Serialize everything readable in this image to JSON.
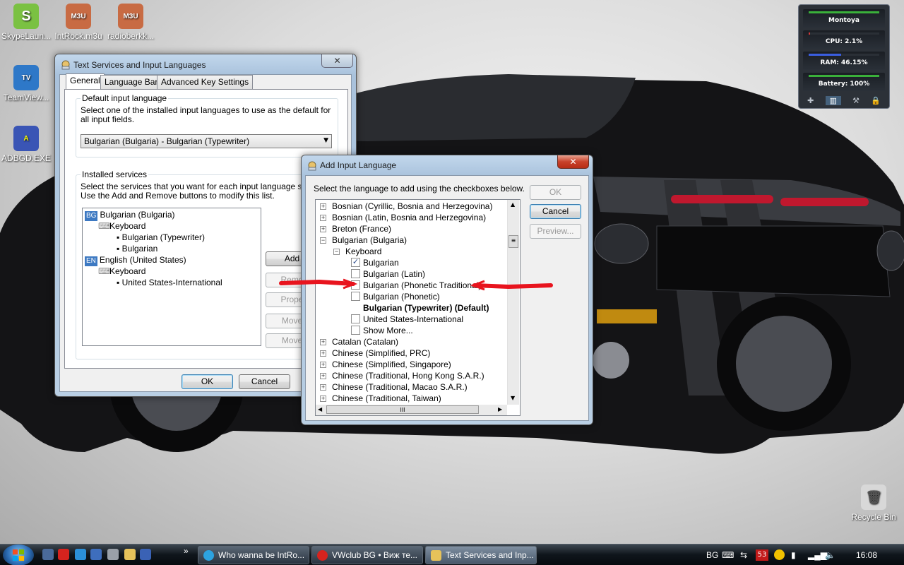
{
  "desktop_icons": [
    {
      "label": "SkypeLaun...",
      "color": "#7ac142",
      "glyph": "S"
    },
    {
      "label": "IntRock.m3u",
      "color": "#c86b43",
      "glyph": "M3U"
    },
    {
      "label": "radioberkk...",
      "color": "#c86b43",
      "glyph": "M3U"
    },
    {
      "label": "TeamView...",
      "color": "#2e78c8",
      "glyph": "TV"
    },
    {
      "label": "ADBGD.EXE",
      "color": "#3a55b5",
      "glyph": "A"
    },
    {
      "label": "Recycle Bin",
      "color": "#d8d8d8",
      "glyph": "🗑"
    }
  ],
  "gadget": {
    "name": "Montoya",
    "cpu": "CPU: 2.1%",
    "ram": "RAM: 46.15%",
    "battery": "Battery: 100%",
    "cpu_level": 0.021,
    "ram_level": 0.4615,
    "battery_level": 1.0,
    "tools": [
      "✚",
      "▥",
      "⚒",
      "🔒"
    ]
  },
  "text_services": {
    "title": "Text Services and Input Languages",
    "close": "✕",
    "tabs": [
      "General",
      "Language Bar",
      "Advanced Key Settings"
    ],
    "default_lang": {
      "legend": "Default input language",
      "description": "Select one of the installed input languages to use as the default for all input fields.",
      "selected": "Bulgarian (Bulgaria) - Bulgarian (Typewriter)"
    },
    "installed": {
      "legend": "Installed services",
      "description": "Select the services that you want for each input language shown i",
      "description2": "Use the Add and Remove buttons to modify this list.",
      "tree": [
        {
          "tag": "BG",
          "label": "Bulgarian (Bulgaria)"
        },
        {
          "label": "Keyboard"
        },
        {
          "label": "Bulgarian (Typewriter)"
        },
        {
          "label": "Bulgarian"
        },
        {
          "tag": "EN",
          "label": "English (United States)"
        },
        {
          "label": "Keyboard"
        },
        {
          "label": "United States-International"
        }
      ],
      "buttons": [
        "Add",
        "Remo",
        "Prope",
        "Move",
        "Move"
      ]
    },
    "ok": "OK",
    "cancel": "Cancel"
  },
  "add_input": {
    "title": "Add Input Language",
    "close": "✕",
    "instruction": "Select the language to add using the checkboxes below.",
    "ok": "OK",
    "cancel": "Cancel",
    "preview": "Preview...",
    "items": [
      {
        "label": "Bosnian (Cyrillic, Bosnia and Herzegovina)",
        "expander": "+"
      },
      {
        "label": "Bosnian (Latin, Bosnia and Herzegovina)",
        "expander": "+"
      },
      {
        "label": "Breton (France)",
        "expander": "+"
      },
      {
        "label": "Bulgarian (Bulgaria)",
        "expander": "−"
      },
      {
        "label": "Keyboard",
        "expander": "−"
      },
      {
        "label": "Bulgarian",
        "checked": true
      },
      {
        "label": "Bulgarian (Latin)",
        "checked": false
      },
      {
        "label": "Bulgarian (Phonetic Traditional)",
        "checked": false
      },
      {
        "label": "Bulgarian (Phonetic)",
        "checked": false
      },
      {
        "label": "Bulgarian (Typewriter) (Default)"
      },
      {
        "label": "United States-International",
        "checked": false
      },
      {
        "label": "Show More...",
        "checked": false
      },
      {
        "label": "Catalan (Catalan)",
        "expander": "+"
      },
      {
        "label": "Chinese (Simplified, PRC)",
        "expander": "+"
      },
      {
        "label": "Chinese (Simplified, Singapore)",
        "expander": "+"
      },
      {
        "label": "Chinese (Traditional, Hong Kong S.A.R.)",
        "expander": "+"
      },
      {
        "label": "Chinese (Traditional, Macao S.A.R.)",
        "expander": "+"
      },
      {
        "label": "Chinese (Traditional, Taiwan)",
        "expander": "+"
      }
    ],
    "hscroll_grip": "III",
    "annotation_color": "#e8141e"
  },
  "taskbar": {
    "quick_launch": [
      "show-desktop",
      "opera",
      "ie",
      "wordpad",
      "tools",
      "folder",
      "app"
    ],
    "quick_colors": [
      "#4a6a9a",
      "#d6231e",
      "#2b8fd8",
      "#3e6ebd",
      "#9aa0a8",
      "#e6c25a",
      "#3a62b5"
    ],
    "overflow": "»",
    "tasks": [
      {
        "label": "Who wanna be IntRo...",
        "color": "#2da3e0"
      },
      {
        "label": "VWclub BG • Виж те...",
        "color": "#d6231e"
      },
      {
        "label": "Text Services and Inp...",
        "color": "#e6c25a"
      }
    ],
    "lang": "BG",
    "badge": "53",
    "time": "16:08"
  }
}
